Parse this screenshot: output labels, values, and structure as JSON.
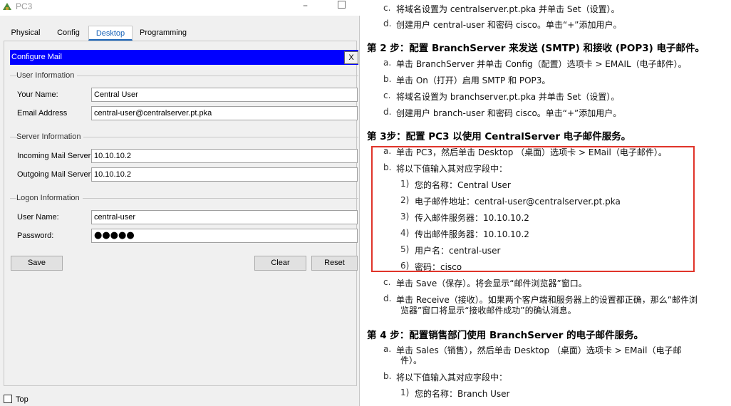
{
  "window": {
    "title": "PC3",
    "tabs": [
      "Physical",
      "Config",
      "Desktop",
      "Programming"
    ],
    "active_tab": "Desktop"
  },
  "dialog": {
    "title": "Configure Mail",
    "close_label": "X",
    "user_info": {
      "group_label": "User Information",
      "name_label": "Your Name:",
      "name_value": "Central User",
      "email_label": "Email Address",
      "email_value": "central-user@centralserver.pt.pka"
    },
    "server_info": {
      "group_label": "Server Information",
      "incoming_label": "Incoming Mail Server",
      "incoming_value": "10.10.10.2",
      "outgoing_label": "Outgoing Mail Server",
      "outgoing_value": "10.10.10.2"
    },
    "logon_info": {
      "group_label": "Logon Information",
      "username_label": "User Name:",
      "username_value": "central-user",
      "password_label": "Password:",
      "password_mask": "●●●●●"
    },
    "buttons": {
      "save": "Save",
      "clear": "Clear",
      "reset": "Reset"
    }
  },
  "footer": {
    "top_label": "Top"
  },
  "document": {
    "lines": [
      {
        "marker": "c.",
        "text": "将域名设置为 centralserver.pt.pka 并单击 Set（设置）。"
      },
      {
        "marker": "d.",
        "text": "创建用户 central-user 和密码 cisco。单击“+”添加用户。"
      },
      {
        "heading": "第 2 步：配置 BranchServer 来发送 (SMTP) 和接收 (POP3) 电子邮件。"
      },
      {
        "marker": "a.",
        "text": "单击 BranchServer 并单击 Config（配置）选项卡 > EMAIL（电子邮件）。"
      },
      {
        "marker": "b.",
        "text": "单击 On（打开）启用 SMTP 和 POP3。"
      },
      {
        "marker": "c.",
        "text": "将域名设置为 branchserver.pt.pka 并单击 Set（设置）。"
      },
      {
        "marker": "d.",
        "text": "创建用户 branch-user 和密码 cisco。单击“+”添加用户。"
      },
      {
        "heading": "第 3步：配置 PC3 以使用 CentralServer 电子邮件服务。"
      },
      {
        "marker": "a.",
        "text": "单击 PC3，然后单击 Desktop （桌面）选项卡 > EMail（电子邮件）。"
      },
      {
        "marker": "b.",
        "text": "将以下值输入其对应字段中："
      },
      {
        "marker": "1)",
        "text": "您的名称：Central User"
      },
      {
        "marker": "2)",
        "text": "电子邮件地址：central-user@centralserver.pt.pka"
      },
      {
        "marker": "3)",
        "text": "传入邮件服务器：10.10.10.2"
      },
      {
        "marker": "4)",
        "text": "传出邮件服务器：10.10.10.2"
      },
      {
        "marker": "5)",
        "text": "用户名：central-user"
      },
      {
        "marker": "6)",
        "text": "密码：cisco"
      },
      {
        "marker": "c.",
        "text": "单击 Save（保存）。将会显示“邮件浏览器”窗口。"
      },
      {
        "marker": "d.",
        "text": "单击 Receive（接收）。如果两个客户端和服务器上的设置都正确，那么“邮件浏"
      },
      {
        "text": "览器”窗口将显示“接收邮件成功”的确认消息。"
      },
      {
        "heading": "第 4 步：配置销售部门使用 BranchServer 的电子邮件服务。"
      },
      {
        "marker": "a.",
        "text": "单击 Sales（销售），然后单击 Desktop （桌面）选项卡 > EMail（电子邮"
      },
      {
        "text": "件）。"
      },
      {
        "marker": "b.",
        "text": "将以下值输入其对应字段中："
      },
      {
        "marker": "1)",
        "text": "您的名称：Branch User"
      }
    ]
  },
  "colors": {
    "dialog_header": "#0000ff",
    "highlight_border": "#e0342a",
    "active_tab": "#1a64b8"
  }
}
